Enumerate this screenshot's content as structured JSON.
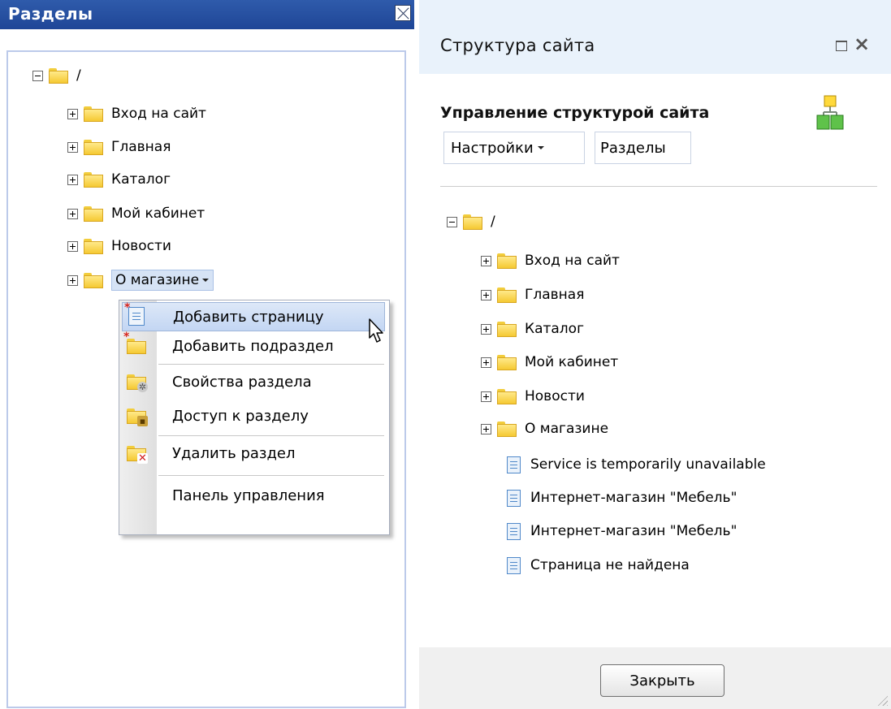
{
  "left_panel": {
    "title": "Разделы",
    "tree": {
      "root_label": "/",
      "items": [
        {
          "label": "Вход на сайт"
        },
        {
          "label": "Главная"
        },
        {
          "label": "Каталог"
        },
        {
          "label": "Мой кабинет"
        },
        {
          "label": "Новости"
        },
        {
          "label": "О магазине"
        }
      ]
    }
  },
  "context_menu": {
    "items": [
      {
        "label": "Добавить страницу",
        "icon": "add-page-icon"
      },
      {
        "label": "Добавить подраздел",
        "icon": "add-folder-icon"
      },
      {
        "label": "Свойства раздела",
        "icon": "folder-settings-icon"
      },
      {
        "label": "Доступ к разделу",
        "icon": "folder-lock-icon"
      },
      {
        "label": "Удалить раздел",
        "icon": "folder-delete-icon"
      },
      {
        "label": "Панель управления",
        "icon": ""
      }
    ]
  },
  "dialog": {
    "title": "Структура сайта",
    "heading": "Управление структурой сайта",
    "settings_button": "Настройки",
    "sections_button": "Разделы",
    "close_button": "Закрыть",
    "tree": {
      "root_label": "/",
      "folders": [
        {
          "label": "Вход на сайт"
        },
        {
          "label": "Главная"
        },
        {
          "label": "Каталог"
        },
        {
          "label": "Мой кабинет"
        },
        {
          "label": "Новости"
        },
        {
          "label": "О магазине"
        }
      ],
      "pages": [
        {
          "label": "Service is temporarily unavailable"
        },
        {
          "label": "Интернет-магазин \"Мебель\""
        },
        {
          "label": "Интернет-магазин \"Мебель\""
        },
        {
          "label": "Страница не найдена"
        }
      ]
    }
  },
  "colors": {
    "left_header": "#2f5bab",
    "dialog_header": "#e9f2fb",
    "menu_hover": "#c3d6f3"
  }
}
